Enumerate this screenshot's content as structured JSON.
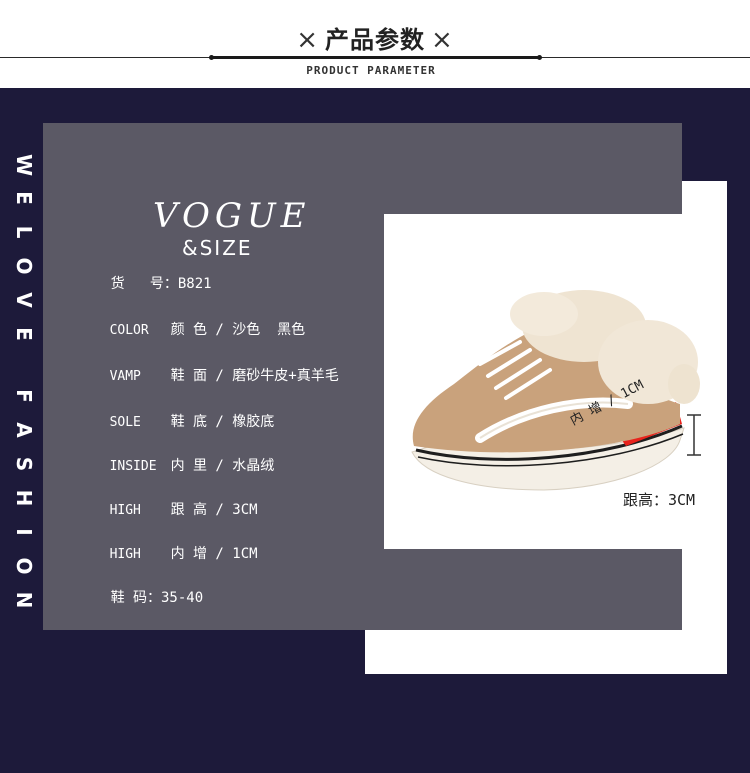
{
  "header": {
    "x_mark": "×",
    "title": "产品参数",
    "subtitle": "PRODUCT PARAMETER"
  },
  "side_text": [
    "W",
    "E",
    "L",
    "O",
    "V",
    "E",
    "F",
    "A",
    "S",
    "H",
    "I",
    "O",
    "N"
  ],
  "brand": {
    "vogue": "VOGUE",
    "size": "&SIZE"
  },
  "specs": [
    {
      "key": "",
      "value": "货   号：B821"
    },
    {
      "key": "COLOR",
      "value": "颜 色 / 沙色  黑色"
    },
    {
      "key": "VAMP",
      "value": "鞋 面 / 磨砂牛皮+真羊毛"
    },
    {
      "key": "SOLE",
      "value": "鞋 底 / 橡胶底"
    },
    {
      "key": "INSIDE",
      "value": "内 里 / 水晶绒"
    },
    {
      "key": "HIGH",
      "value": "跟 高 / 3CM"
    },
    {
      "key": "HIGH",
      "value": "内 增 / 1CM"
    },
    {
      "key": "",
      "value": "鞋 码：35-40"
    }
  ],
  "photo": {
    "inner_label": "内 增 / 1CM",
    "heel_label": "跟高：3CM"
  },
  "colors": {
    "background": "#1d1a3a",
    "card": "#5b5965",
    "accent_red": "#e8231c",
    "shoe_tan": "#c9a27c"
  }
}
